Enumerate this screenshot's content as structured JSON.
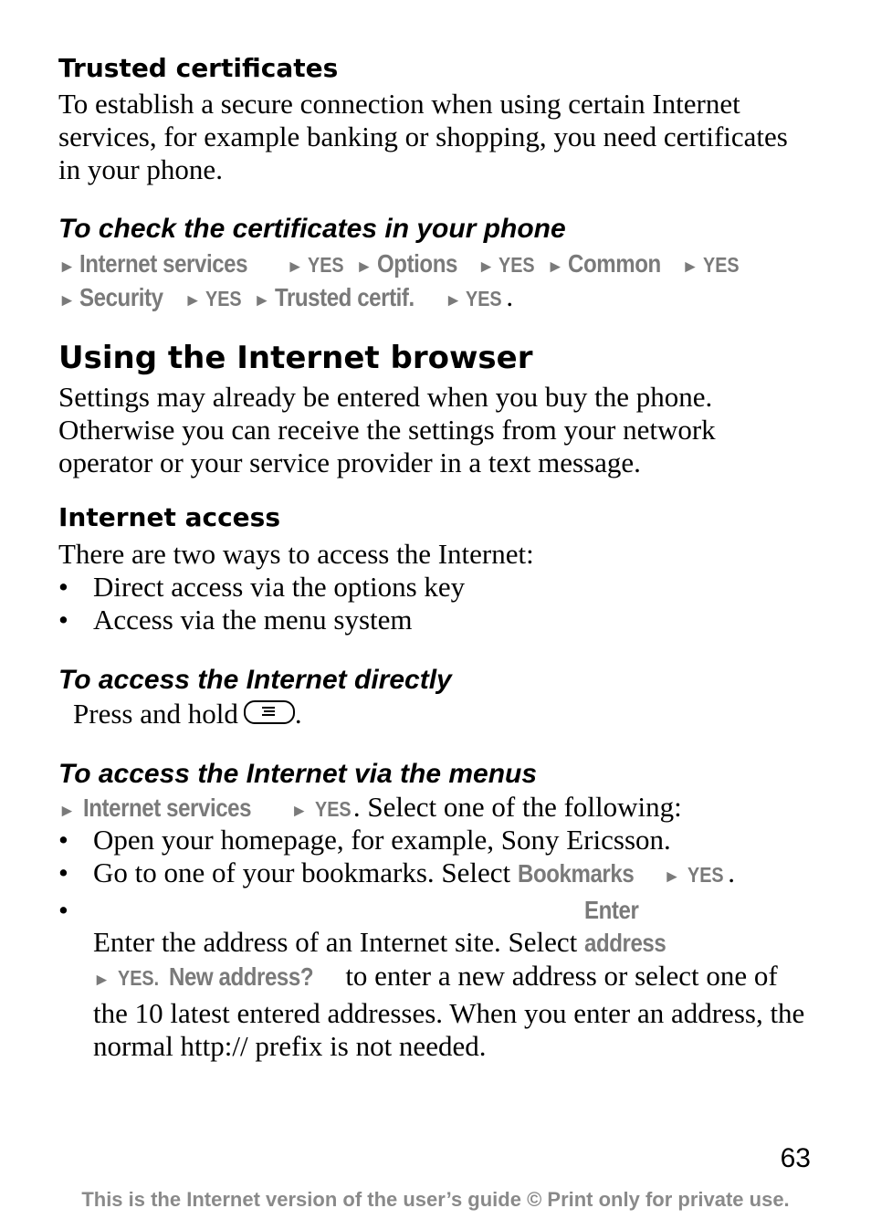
{
  "sections": {
    "trusted": {
      "heading": "Trusted certificates",
      "body": "To establish a secure connection when using certain Internet services, for example banking or shopping, you need certificates in your phone."
    },
    "check_certs": {
      "heading": "To check the certificates in your phone",
      "path_line1": [
        "Internet services",
        "YES",
        "Options",
        "YES",
        "Common",
        "YES"
      ],
      "path_line2": [
        "Security",
        "YES",
        "Trusted certif.",
        "YES"
      ]
    },
    "browser": {
      "heading": "Using the Internet browser",
      "body": "Settings may already be entered when you buy the phone. Otherwise you can receive the settings from your network operator or your service provider in a text message."
    },
    "access": {
      "heading": "Internet access",
      "intro": "There are two ways to access the Internet:",
      "bullets": [
        "Direct access via the options key",
        "Access via the menu system"
      ]
    },
    "directly": {
      "heading": "To access the Internet directly",
      "text": "Press and hold",
      "icon": "options-key-icon"
    },
    "via_menus": {
      "heading": "To access the Internet via the menus",
      "path": [
        "Internet services",
        "YES"
      ],
      "path_suffix": ". Select one of the following:",
      "bullet1": "Open your homepage, for example, Sony Ericsson.",
      "bullet2_text": "Go to one of your bookmarks. Select ",
      "bullet2_menu": "Bookmarks",
      "bullet2_yes": "YES",
      "bullet3_text": "Enter the address of an Internet site. Select ",
      "bullet3_menu": "Enter address",
      "bullet3_yes": "YES.",
      "bullet3_menu2": "New address?",
      "bullet3_rest": " to enter a new address or select one of the 10 latest entered addresses. When you enter an address, the normal http:// prefix is not needed."
    }
  },
  "arrow_glyph": "►",
  "bullet_glyph": "•",
  "page_number": "63",
  "footer": "This is the Internet version of the user’s guide © Print only for private use."
}
